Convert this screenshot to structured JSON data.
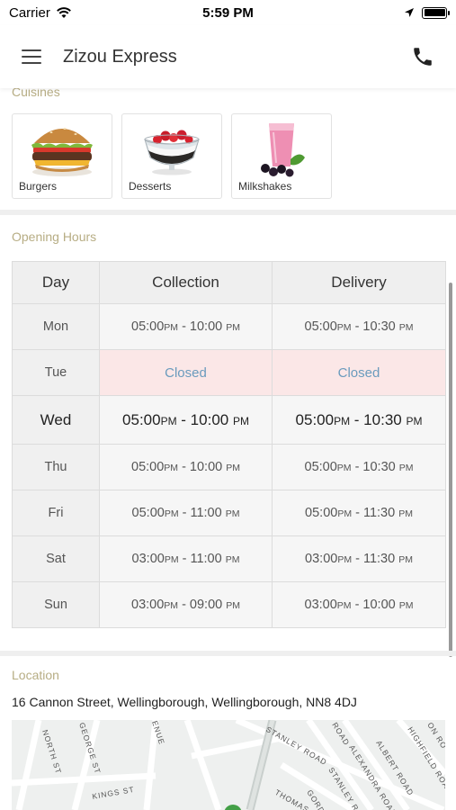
{
  "status_bar": {
    "carrier": "Carrier",
    "time": "5:59 PM"
  },
  "header": {
    "title": "Zizou Express"
  },
  "cuisines": {
    "label": "Cuisines",
    "items": [
      {
        "name": "Burgers"
      },
      {
        "name": "Desserts"
      },
      {
        "name": "Milkshakes"
      }
    ]
  },
  "opening_hours": {
    "label": "Opening Hours",
    "columns": [
      "Day",
      "Collection",
      "Delivery"
    ],
    "rows": [
      {
        "day": "Mon",
        "collection": [
          "05:00",
          "PM",
          " - 10:00 ",
          "PM"
        ],
        "delivery": [
          "05:00",
          "PM",
          " - 10:30 ",
          "PM"
        ]
      },
      {
        "day": "Tue",
        "closed": true,
        "collection_text": "Closed",
        "delivery_text": "Closed"
      },
      {
        "day": "Wed",
        "today": true,
        "collection": [
          "05:00",
          "PM",
          " - 10:00 ",
          "PM"
        ],
        "delivery": [
          "05:00",
          "PM",
          " - 10:30 ",
          "PM"
        ]
      },
      {
        "day": "Thu",
        "collection": [
          "05:00",
          "PM",
          " - 10:00 ",
          "PM"
        ],
        "delivery": [
          "05:00",
          "PM",
          " - 10:30 ",
          "PM"
        ]
      },
      {
        "day": "Fri",
        "collection": [
          "05:00",
          "PM",
          " - 11:00 ",
          "PM"
        ],
        "delivery": [
          "05:00",
          "PM",
          " - 11:30 ",
          "PM"
        ]
      },
      {
        "day": "Sat",
        "collection": [
          "03:00",
          "PM",
          " - 11:00 ",
          "PM"
        ],
        "delivery": [
          "03:00",
          "PM",
          " - 11:30 ",
          "PM"
        ]
      },
      {
        "day": "Sun",
        "collection": [
          "03:00",
          "PM",
          " - 09:00 ",
          "PM"
        ],
        "delivery": [
          "03:00",
          "PM",
          " - 10:00 ",
          "PM"
        ]
      }
    ]
  },
  "location": {
    "label": "Location",
    "address": "16 Cannon Street, Wellingborough, Wellingborough, NN8 4DJ",
    "map_streets": [
      "NORTH ST",
      "GEORGE ST",
      "ENUE",
      "KINGS ST",
      "STANLEY ROAD",
      "ALEXANDRA ROAD",
      "ALBERT ROAD",
      "HIGHFIELD ROAD",
      "STANLEY ROAD",
      "THOMAS",
      "GORDO",
      "ON RO",
      "ROAD"
    ]
  },
  "colors": {
    "section_label": "#b7ad84",
    "closed_bg": "#fbe7e7",
    "closed_text": "#6a9bbd"
  },
  "icons": {
    "menu": "hamburger-icon",
    "phone": "phone-icon",
    "wifi": "wifi-icon",
    "location": "location-arrow-icon",
    "battery": "battery-icon"
  }
}
